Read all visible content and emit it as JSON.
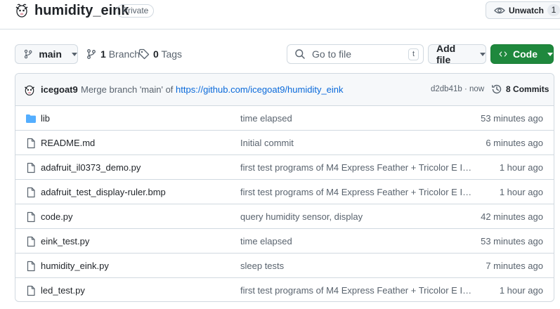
{
  "repo": {
    "name": "humidity_eink",
    "visibility": "Private",
    "watch_label": "Unwatch",
    "watch_count": "1"
  },
  "toolbar": {
    "branch": "main",
    "branch_count": "1",
    "branch_label": "Branch",
    "tag_count": "0",
    "tag_label": "Tags",
    "search_placeholder": "Go to file",
    "search_shortcut": "t",
    "add_file": "Add file",
    "code": "Code"
  },
  "latest_commit": {
    "author": "icegoat9",
    "message_prefix": "Merge branch 'main' of",
    "message_link": "https://github.com/icegoat9/humidity_eink",
    "hash": "d2db41b",
    "separator": "·",
    "age": "now",
    "commits_count": "8",
    "commits_label": "Commits"
  },
  "files": [
    {
      "name": "lib",
      "type": "folder",
      "message": "time elapsed",
      "age": "53 minutes ago"
    },
    {
      "name": "README.md",
      "type": "file",
      "message": "Initial commit",
      "age": "6 minutes ago"
    },
    {
      "name": "adafruit_il0373_demo.py",
      "type": "file",
      "message": "first test programs of M4 Express Feather + Tricolor E Ink ...",
      "age": "1 hour ago"
    },
    {
      "name": "adafruit_test_display-ruler.bmp",
      "type": "file",
      "message": "first test programs of M4 Express Feather + Tricolor E Ink ...",
      "age": "1 hour ago"
    },
    {
      "name": "code.py",
      "type": "file",
      "message": "query humidity sensor, display",
      "age": "42 minutes ago"
    },
    {
      "name": "eink_test.py",
      "type": "file",
      "message": "time elapsed",
      "age": "53 minutes ago"
    },
    {
      "name": "humidity_eink.py",
      "type": "file",
      "message": "sleep tests",
      "age": "7 minutes ago"
    },
    {
      "name": "led_test.py",
      "type": "file",
      "message": "first test programs of M4 Express Feather + Tricolor E Ink ...",
      "age": "1 hour ago"
    }
  ],
  "icons": {
    "folder_color": "#54aeff",
    "file_color": "#59636e",
    "code_button_color": "#1f883d",
    "link_color": "#0969da"
  }
}
